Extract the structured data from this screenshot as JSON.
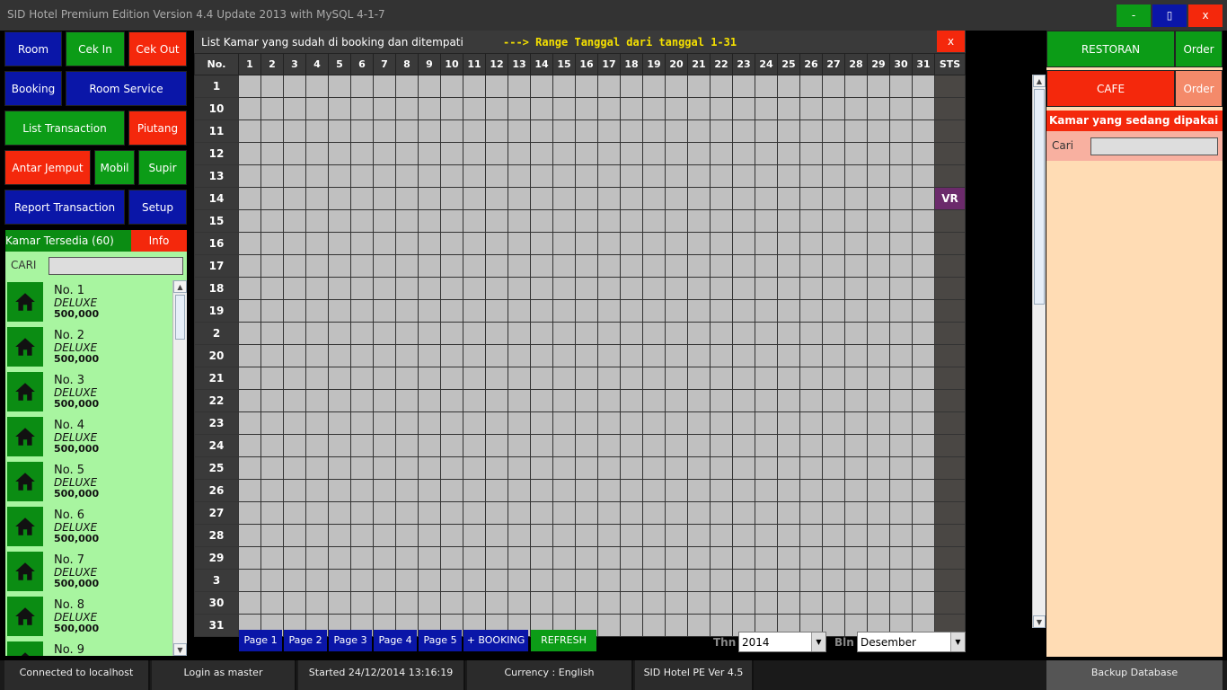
{
  "window": {
    "title": "SID Hotel Premium Edition Version 4.4 Update 2013 with MySQL 4-1-7",
    "minimize": "-",
    "maximize": "▯",
    "close": "x"
  },
  "menu": {
    "room": "Room",
    "cek_in": "Cek In",
    "cek_out": "Cek Out",
    "booking": "Booking",
    "room_service": "Room Service",
    "list_transaction": "List Transaction",
    "piutang": "Piutang",
    "antar_jemput": "Antar Jemput",
    "mobil": "Mobil",
    "supir": "Supir",
    "report_transaction": "Report Transaction",
    "setup": "Setup"
  },
  "rooms_panel": {
    "header": "Kamar Tersedia (60)",
    "info": "Info",
    "search_label": "CARI",
    "search_value": "",
    "items": [
      {
        "no": "No. 1",
        "type": "DELUXE",
        "price": "500,000"
      },
      {
        "no": "No. 2",
        "type": "DELUXE",
        "price": "500,000"
      },
      {
        "no": "No. 3",
        "type": "DELUXE",
        "price": "500,000"
      },
      {
        "no": "No. 4",
        "type": "DELUXE",
        "price": "500,000"
      },
      {
        "no": "No. 5",
        "type": "DELUXE",
        "price": "500,000"
      },
      {
        "no": "No. 6",
        "type": "DELUXE",
        "price": "500,000"
      },
      {
        "no": "No. 7",
        "type": "DELUXE",
        "price": "500,000"
      },
      {
        "no": "No. 8",
        "type": "DELUXE",
        "price": "500,000"
      },
      {
        "no": "No. 9",
        "type": "",
        "price": ""
      }
    ],
    "icon": "house-icon"
  },
  "grid": {
    "title": "List Kamar yang sudah di booking dan ditempati",
    "range": "---> Range Tanggal dari tanggal 1-31",
    "close": "x",
    "col_no": "No.",
    "days": [
      "1",
      "2",
      "3",
      "4",
      "5",
      "6",
      "7",
      "8",
      "9",
      "10",
      "11",
      "12",
      "13",
      "14",
      "15",
      "16",
      "17",
      "18",
      "19",
      "20",
      "21",
      "22",
      "23",
      "24",
      "25",
      "26",
      "27",
      "28",
      "29",
      "30",
      "31"
    ],
    "col_sts": "STS",
    "rows": [
      {
        "room": "1",
        "sts": ""
      },
      {
        "room": "10",
        "sts": ""
      },
      {
        "room": "11",
        "sts": ""
      },
      {
        "room": "12",
        "sts": ""
      },
      {
        "room": "13",
        "sts": ""
      },
      {
        "room": "14",
        "sts": "VR"
      },
      {
        "room": "15",
        "sts": ""
      },
      {
        "room": "16",
        "sts": ""
      },
      {
        "room": "17",
        "sts": ""
      },
      {
        "room": "18",
        "sts": ""
      },
      {
        "room": "19",
        "sts": ""
      },
      {
        "room": "2",
        "sts": ""
      },
      {
        "room": "20",
        "sts": ""
      },
      {
        "room": "21",
        "sts": ""
      },
      {
        "room": "22",
        "sts": ""
      },
      {
        "room": "23",
        "sts": ""
      },
      {
        "room": "24",
        "sts": ""
      },
      {
        "room": "25",
        "sts": ""
      },
      {
        "room": "26",
        "sts": ""
      },
      {
        "room": "27",
        "sts": ""
      },
      {
        "room": "28",
        "sts": ""
      },
      {
        "room": "29",
        "sts": ""
      },
      {
        "room": "3",
        "sts": ""
      },
      {
        "room": "30",
        "sts": ""
      },
      {
        "room": "31",
        "sts": ""
      }
    ],
    "pages": [
      "Page 1",
      "Page 2",
      "Page 3",
      "Page 4",
      "Page 5"
    ],
    "add_booking": "+ BOOKING",
    "refresh": "REFRESH",
    "year_label": "Thn",
    "year_value": "2014",
    "month_label": "Bln",
    "month_value": "Desember"
  },
  "right_panel": {
    "restoran": "RESTORAN",
    "order1": "Order",
    "cafe": "CAFE",
    "order2": "Order",
    "used_rooms_header": "Kamar yang sedang dipakai",
    "search_label": "Cari",
    "search_value": ""
  },
  "statusbar": {
    "connected": "Connected to localhost",
    "login": "Login as master",
    "started": "Started 24/12/2014 13:16:19",
    "currency": "Currency : English",
    "version": "SID Hotel PE Ver 4.5",
    "backup": "Backup Database"
  },
  "colors": {
    "green": "#0c9c17",
    "red": "#f4280c",
    "blue": "#0a16a8",
    "grid_cell": "#c0c0c0",
    "vr_status": "#6b2a6b"
  }
}
